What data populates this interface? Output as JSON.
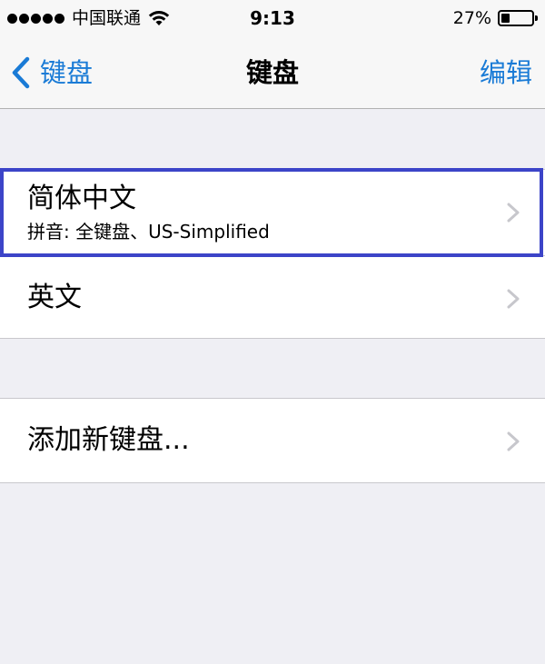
{
  "status_bar": {
    "carrier": "中国联通",
    "time": "9:13",
    "battery_percent": "27%",
    "battery_level": 0.27,
    "signal_bars": 5,
    "icons": [
      "signal-dots-icon",
      "wifi-icon",
      "battery-icon"
    ]
  },
  "nav": {
    "back_label": "键盘",
    "title": "键盘",
    "edit_label": "编辑",
    "accent_color": "#1a7bd6"
  },
  "keyboards": [
    {
      "title": "简体中文",
      "subtitle": "拼音: 全键盘、US-Simplified",
      "highlighted": true
    },
    {
      "title": "英文"
    }
  ],
  "add_keyboard": {
    "label": "添加新键盘..."
  },
  "highlight_color": "#3c44c8"
}
